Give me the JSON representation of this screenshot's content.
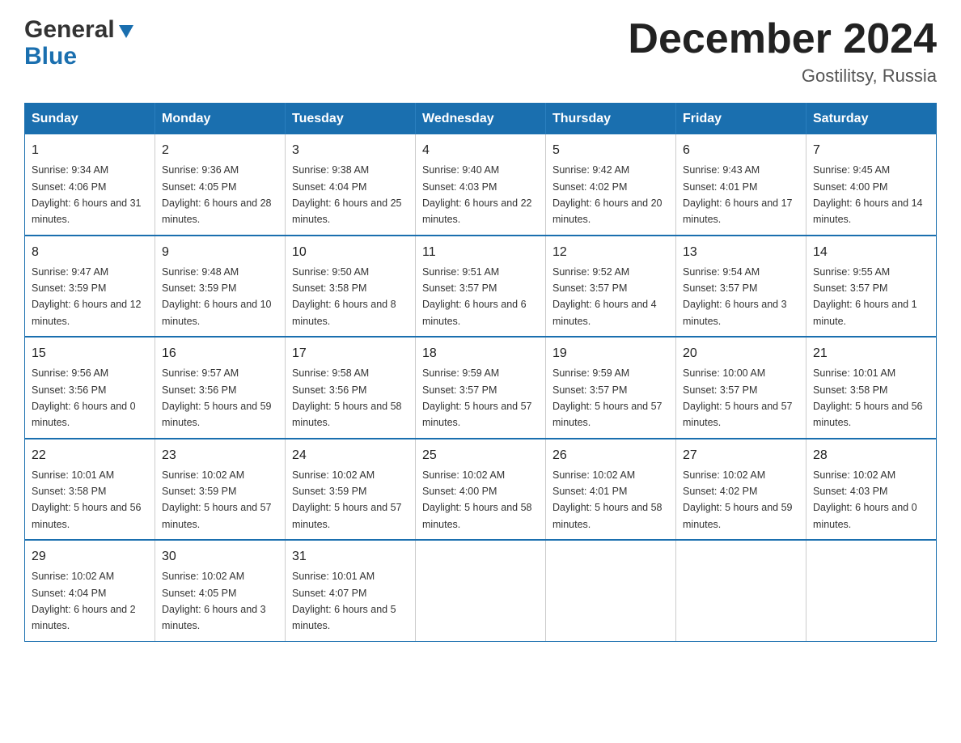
{
  "logo": {
    "general": "General",
    "blue": "Blue"
  },
  "title": {
    "main": "December 2024",
    "sub": "Gostilitsy, Russia"
  },
  "days_of_week": [
    "Sunday",
    "Monday",
    "Tuesday",
    "Wednesday",
    "Thursday",
    "Friday",
    "Saturday"
  ],
  "weeks": [
    [
      {
        "day": "1",
        "sunrise": "9:34 AM",
        "sunset": "4:06 PM",
        "daylight": "6 hours and 31 minutes."
      },
      {
        "day": "2",
        "sunrise": "9:36 AM",
        "sunset": "4:05 PM",
        "daylight": "6 hours and 28 minutes."
      },
      {
        "day": "3",
        "sunrise": "9:38 AM",
        "sunset": "4:04 PM",
        "daylight": "6 hours and 25 minutes."
      },
      {
        "day": "4",
        "sunrise": "9:40 AM",
        "sunset": "4:03 PM",
        "daylight": "6 hours and 22 minutes."
      },
      {
        "day": "5",
        "sunrise": "9:42 AM",
        "sunset": "4:02 PM",
        "daylight": "6 hours and 20 minutes."
      },
      {
        "day": "6",
        "sunrise": "9:43 AM",
        "sunset": "4:01 PM",
        "daylight": "6 hours and 17 minutes."
      },
      {
        "day": "7",
        "sunrise": "9:45 AM",
        "sunset": "4:00 PM",
        "daylight": "6 hours and 14 minutes."
      }
    ],
    [
      {
        "day": "8",
        "sunrise": "9:47 AM",
        "sunset": "3:59 PM",
        "daylight": "6 hours and 12 minutes."
      },
      {
        "day": "9",
        "sunrise": "9:48 AM",
        "sunset": "3:59 PM",
        "daylight": "6 hours and 10 minutes."
      },
      {
        "day": "10",
        "sunrise": "9:50 AM",
        "sunset": "3:58 PM",
        "daylight": "6 hours and 8 minutes."
      },
      {
        "day": "11",
        "sunrise": "9:51 AM",
        "sunset": "3:57 PM",
        "daylight": "6 hours and 6 minutes."
      },
      {
        "day": "12",
        "sunrise": "9:52 AM",
        "sunset": "3:57 PM",
        "daylight": "6 hours and 4 minutes."
      },
      {
        "day": "13",
        "sunrise": "9:54 AM",
        "sunset": "3:57 PM",
        "daylight": "6 hours and 3 minutes."
      },
      {
        "day": "14",
        "sunrise": "9:55 AM",
        "sunset": "3:57 PM",
        "daylight": "6 hours and 1 minute."
      }
    ],
    [
      {
        "day": "15",
        "sunrise": "9:56 AM",
        "sunset": "3:56 PM",
        "daylight": "6 hours and 0 minutes."
      },
      {
        "day": "16",
        "sunrise": "9:57 AM",
        "sunset": "3:56 PM",
        "daylight": "5 hours and 59 minutes."
      },
      {
        "day": "17",
        "sunrise": "9:58 AM",
        "sunset": "3:56 PM",
        "daylight": "5 hours and 58 minutes."
      },
      {
        "day": "18",
        "sunrise": "9:59 AM",
        "sunset": "3:57 PM",
        "daylight": "5 hours and 57 minutes."
      },
      {
        "day": "19",
        "sunrise": "9:59 AM",
        "sunset": "3:57 PM",
        "daylight": "5 hours and 57 minutes."
      },
      {
        "day": "20",
        "sunrise": "10:00 AM",
        "sunset": "3:57 PM",
        "daylight": "5 hours and 57 minutes."
      },
      {
        "day": "21",
        "sunrise": "10:01 AM",
        "sunset": "3:58 PM",
        "daylight": "5 hours and 56 minutes."
      }
    ],
    [
      {
        "day": "22",
        "sunrise": "10:01 AM",
        "sunset": "3:58 PM",
        "daylight": "5 hours and 56 minutes."
      },
      {
        "day": "23",
        "sunrise": "10:02 AM",
        "sunset": "3:59 PM",
        "daylight": "5 hours and 57 minutes."
      },
      {
        "day": "24",
        "sunrise": "10:02 AM",
        "sunset": "3:59 PM",
        "daylight": "5 hours and 57 minutes."
      },
      {
        "day": "25",
        "sunrise": "10:02 AM",
        "sunset": "4:00 PM",
        "daylight": "5 hours and 58 minutes."
      },
      {
        "day": "26",
        "sunrise": "10:02 AM",
        "sunset": "4:01 PM",
        "daylight": "5 hours and 58 minutes."
      },
      {
        "day": "27",
        "sunrise": "10:02 AM",
        "sunset": "4:02 PM",
        "daylight": "5 hours and 59 minutes."
      },
      {
        "day": "28",
        "sunrise": "10:02 AM",
        "sunset": "4:03 PM",
        "daylight": "6 hours and 0 minutes."
      }
    ],
    [
      {
        "day": "29",
        "sunrise": "10:02 AM",
        "sunset": "4:04 PM",
        "daylight": "6 hours and 2 minutes."
      },
      {
        "day": "30",
        "sunrise": "10:02 AM",
        "sunset": "4:05 PM",
        "daylight": "6 hours and 3 minutes."
      },
      {
        "day": "31",
        "sunrise": "10:01 AM",
        "sunset": "4:07 PM",
        "daylight": "6 hours and 5 minutes."
      },
      null,
      null,
      null,
      null
    ]
  ]
}
